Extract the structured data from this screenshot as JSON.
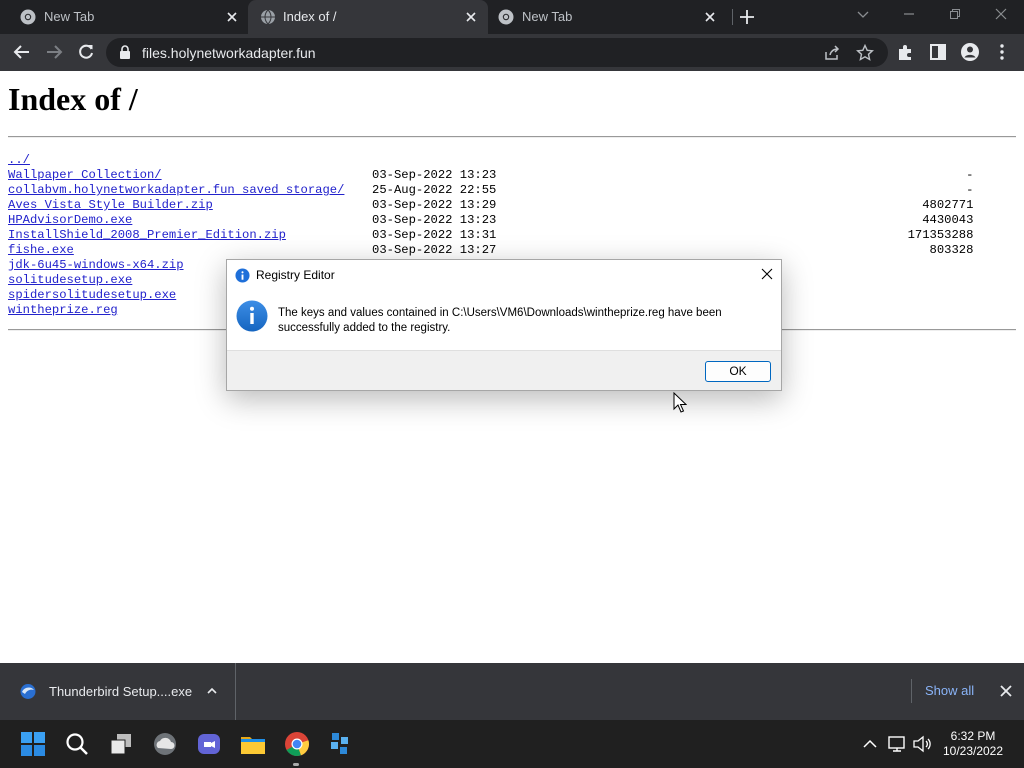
{
  "browser": {
    "tabs": [
      {
        "title": "New Tab",
        "active": false
      },
      {
        "title": "Index of /",
        "active": true
      },
      {
        "title": "New Tab",
        "active": false
      }
    ],
    "url": "files.holynetworkadapter.fun"
  },
  "page": {
    "heading": "Index of /",
    "parent_link": "../",
    "entries": [
      {
        "name": "Wallpaper Collection/",
        "date": "03-Sep-2022 13:23",
        "size": "-"
      },
      {
        "name": "collabvm.holynetworkadapter.fun saved storage/",
        "date": "25-Aug-2022 22:55",
        "size": "-"
      },
      {
        "name": "Aves Vista Style Builder.zip",
        "date": "03-Sep-2022 13:29",
        "size": "4802771"
      },
      {
        "name": "HPAdvisorDemo.exe",
        "date": "03-Sep-2022 13:23",
        "size": "4430043"
      },
      {
        "name": "InstallShield_2008_Premier_Edition.zip",
        "date": "03-Sep-2022 13:31",
        "size": "171353288"
      },
      {
        "name": "fishe.exe",
        "date": "03-Sep-2022 13:27",
        "size": "803328"
      },
      {
        "name": "jdk-6u45-windows-x64.zip",
        "date": "",
        "size": ""
      },
      {
        "name": "solitudesetup.exe",
        "date": "",
        "size": ""
      },
      {
        "name": "spidersolitudesetup.exe",
        "date": "",
        "size": ""
      },
      {
        "name": "wintheprize.reg",
        "date": "",
        "size": ""
      }
    ]
  },
  "dialog": {
    "title": "Registry Editor",
    "message": "The keys and values contained in C:\\Users\\VM6\\Downloads\\wintheprize.reg have been successfully added to the registry.",
    "ok_label": "OK"
  },
  "downloads": {
    "item_name": "Thunderbird Setup....exe",
    "show_all_label": "Show all"
  },
  "taskbar": {
    "time": "6:32 PM",
    "date": "10/23/2022"
  },
  "colors": {
    "tabstrip_bg": "#202124",
    "toolbar_bg": "#35363a",
    "link": "#2222cc",
    "accent": "#0067c0",
    "show_all": "#8ab4f8",
    "taskbar_bg": "#202020"
  }
}
